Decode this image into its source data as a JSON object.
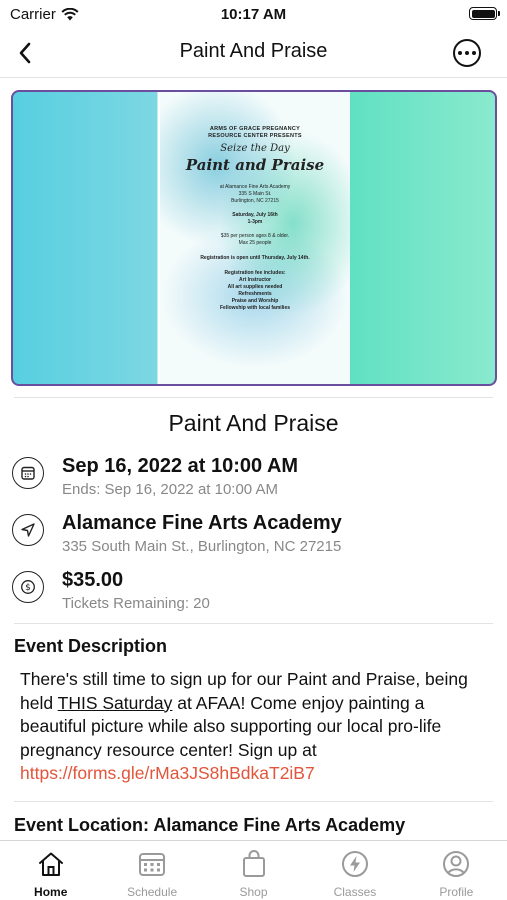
{
  "status_bar": {
    "carrier": "Carrier",
    "time": "10:17 AM"
  },
  "nav": {
    "title": "Paint And Praise"
  },
  "banner": {
    "org": "ARMS OF GRACE PREGNANCY RESOURCE CENTER PRESENTS",
    "seize": "Seize the Day",
    "title": "Paint and Praise",
    "venue": "at Alamance Fine Arts Academy",
    "address1": "335 S Main St.",
    "address2": "Burlington, NC 27215",
    "date": "Saturday, July 16th",
    "time": "1-3pm",
    "price": "$35 per person ages 8 & older.",
    "capacity": "Max 25 people",
    "registration": "Registration is open until Thursday, July 14th.",
    "includes_head": "Registration fee includes:",
    "includes": [
      "Art Instructor",
      "All art supplies needed",
      "Refreshments",
      "Praise and Worship",
      "Fellowship with local families"
    ]
  },
  "event": {
    "title": "Paint And Praise",
    "date": "Sep 16, 2022 at 10:00 AM",
    "ends": "Ends: Sep 16, 2022 at 10:00 AM",
    "location_name": "Alamance Fine Arts Academy",
    "location_address": "335 South Main St., Burlington, NC 27215",
    "price": "$35.00",
    "tickets": "Tickets Remaining: 20"
  },
  "description": {
    "heading": "Event Description",
    "part1": "There's still time to sign up for our Paint and Praise, being held ",
    "underlined": "THIS Saturday",
    "part2": " at AFAA! Come enjoy painting a beautiful picture while also supporting our local pro-life pregnancy resource center! Sign up at ",
    "link": "https://forms.gle/rMa3JS8hBdkaT2iB7"
  },
  "location_section": {
    "heading": "Event Location: Alamance Fine Arts Academy"
  },
  "tabs": [
    {
      "label": "Home",
      "icon": "home-icon"
    },
    {
      "label": "Schedule",
      "icon": "calendar-icon"
    },
    {
      "label": "Shop",
      "icon": "bag-icon"
    },
    {
      "label": "Classes",
      "icon": "lightning-icon"
    },
    {
      "label": "Profile",
      "icon": "user-icon"
    }
  ],
  "colors": {
    "accent_link": "#e2553a",
    "banner_border": "#6b4e9e"
  }
}
